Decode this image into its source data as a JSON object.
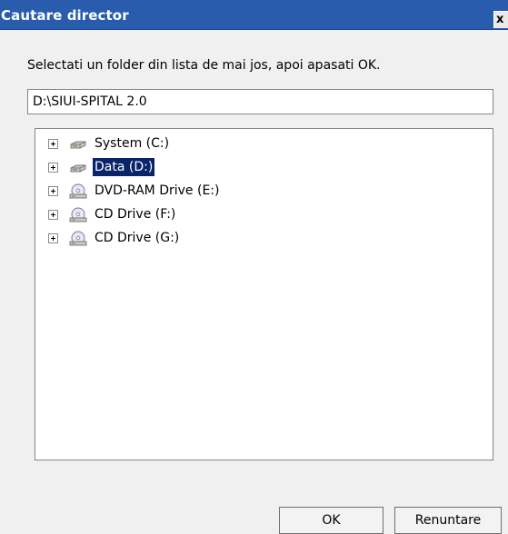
{
  "window": {
    "title": "Cautare director",
    "close_label": "x"
  },
  "prompt": "Selectati un folder din lista de mai jos, apoi apasati OK.",
  "path_field": {
    "value": "D:\\SIUI-SPITAL 2.0"
  },
  "tree": {
    "items": [
      {
        "label": "System (C:)",
        "icon": "hard-drive-icon",
        "expander": "plus",
        "selected": false
      },
      {
        "label": "Data (D:)",
        "icon": "hard-drive-icon",
        "expander": "plus",
        "selected": true
      },
      {
        "label": "DVD-RAM Drive (E:)",
        "icon": "optical-drive-icon",
        "expander": "plus",
        "selected": false
      },
      {
        "label": "CD Drive (F:)",
        "icon": "optical-drive-icon",
        "expander": "plus",
        "selected": false
      },
      {
        "label": "CD Drive (G:)",
        "icon": "optical-drive-icon",
        "expander": "plus",
        "selected": false
      }
    ]
  },
  "buttons": {
    "ok": "OK",
    "cancel": "Renuntare"
  },
  "colors": {
    "titlebar": "#2a5cad",
    "selection": "#0a246a"
  }
}
